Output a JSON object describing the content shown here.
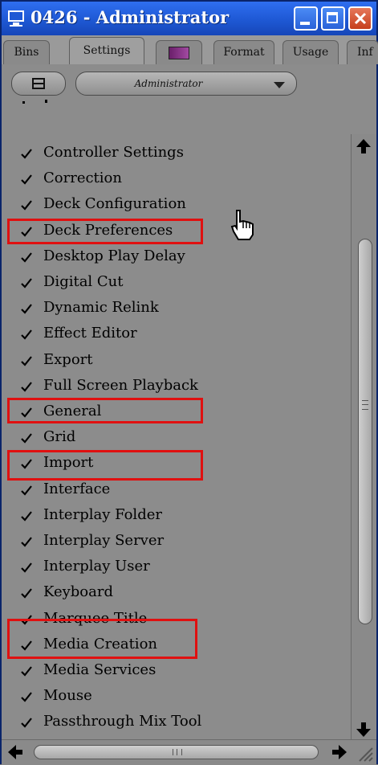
{
  "window": {
    "title": "0426 - Administrator"
  },
  "tabs": [
    {
      "label": "Bins"
    },
    {
      "label": "Settings"
    },
    {
      "label": ""
    },
    {
      "label": "Format"
    },
    {
      "label": "Usage"
    },
    {
      "label": "Inf"
    }
  ],
  "toolbar": {
    "dropdown_value": "Administrator"
  },
  "settings": [
    {
      "label": "Controller Settings"
    },
    {
      "label": "Correction"
    },
    {
      "label": "Deck Configuration"
    },
    {
      "label": "Deck Preferences"
    },
    {
      "label": "Desktop Play Delay"
    },
    {
      "label": "Digital Cut"
    },
    {
      "label": "Dynamic Relink"
    },
    {
      "label": "Effect Editor"
    },
    {
      "label": "Export"
    },
    {
      "label": "Full Screen Playback"
    },
    {
      "label": "General"
    },
    {
      "label": "Grid"
    },
    {
      "label": "Import"
    },
    {
      "label": "Interface"
    },
    {
      "label": "Interplay Folder"
    },
    {
      "label": "Interplay Server"
    },
    {
      "label": "Interplay User"
    },
    {
      "label": "Keyboard"
    },
    {
      "label": "Marquee Title"
    },
    {
      "label": "Media Creation"
    },
    {
      "label": "Media Services"
    },
    {
      "label": "Mouse"
    },
    {
      "label": "Passthrough Mix Tool"
    }
  ],
  "highlighted": [
    "Deck Preferences",
    "General",
    "Import",
    "Media Creation"
  ],
  "colors": {
    "titlebar": "#1e58d4",
    "highlight": "#e01010",
    "panel": "#8c8c8c"
  },
  "icons": {
    "window": "monitor-icon",
    "cursor": "hand-pointer-icon",
    "check": "checkmark-icon"
  }
}
